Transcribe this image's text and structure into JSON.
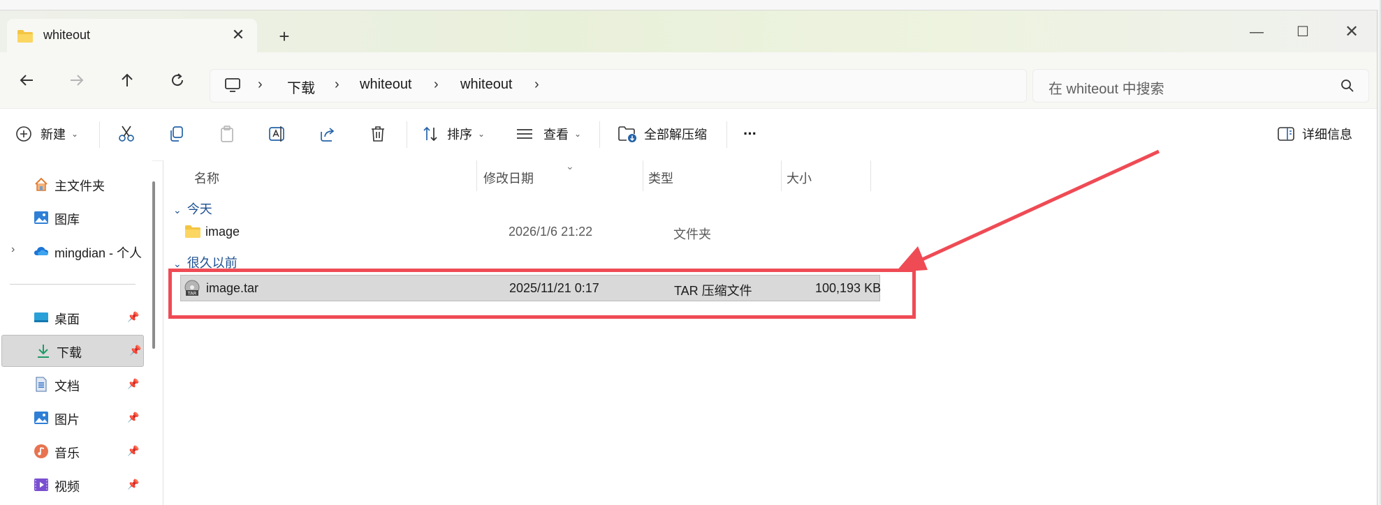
{
  "window": {
    "tab_title": "whiteout",
    "tab_close": "✕",
    "new_tab": "+",
    "controls": {
      "minimize": "—",
      "maximize": "☐",
      "close": "✕"
    }
  },
  "nav": {
    "breadcrumbs": [
      "下载",
      "whiteout",
      "whiteout"
    ],
    "search_placeholder": "在 whiteout 中搜索"
  },
  "toolbar": {
    "new_label": "新建",
    "sort_label": "排序",
    "view_label": "查看",
    "extract_label": "全部解压缩",
    "more_label": "···",
    "details_label": "详细信息"
  },
  "sidebar": {
    "items": [
      {
        "label": "主文件夹",
        "icon": "home-icon"
      },
      {
        "label": "图库",
        "icon": "gallery-icon"
      },
      {
        "label": "mingdian - 个人",
        "icon": "onedrive-icon"
      },
      {
        "label": "桌面",
        "icon": "desktop-icon",
        "pinned": true
      },
      {
        "label": "下载",
        "icon": "download-icon",
        "pinned": true,
        "selected": true
      },
      {
        "label": "文档",
        "icon": "documents-icon",
        "pinned": true
      },
      {
        "label": "图片",
        "icon": "pictures-icon",
        "pinned": true
      },
      {
        "label": "音乐",
        "icon": "music-icon",
        "pinned": true
      },
      {
        "label": "视频",
        "icon": "videos-icon",
        "pinned": true
      }
    ]
  },
  "content": {
    "columns": [
      "名称",
      "修改日期",
      "类型",
      "大小"
    ],
    "groups": [
      {
        "label": "今天",
        "files": [
          {
            "name": "image",
            "modified": "2026/1/6 21:22",
            "type": "文件夹",
            "size": "",
            "icon": "folder-icon"
          }
        ]
      },
      {
        "label": "很久以前",
        "files": [
          {
            "name": "image.tar",
            "modified": "2025/11/21 0:17",
            "type": "TAR 压缩文件",
            "size": "100,193 KB",
            "icon": "tar-archive-icon",
            "selected": true
          }
        ]
      }
    ]
  },
  "colors": {
    "annotation": "#ef4b55",
    "group_header": "#1d4f91",
    "folder": "#f4c542"
  }
}
